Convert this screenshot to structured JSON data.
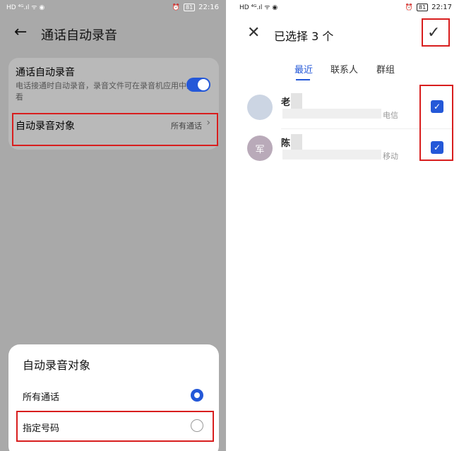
{
  "left": {
    "status": {
      "time": "22:16",
      "battery": "81",
      "signal": "HD ⁴ᴳ.ıl ᯤ ◉"
    },
    "title": "通话自动录音",
    "auto_record": {
      "title": "通话自动录音",
      "desc": "电话接通时自动录音，录音文件可在录音机应用中查看"
    },
    "target": {
      "title": "自动录音对象",
      "value": "所有通话"
    },
    "sheet": {
      "title": "自动录音对象",
      "options": [
        {
          "label": "所有通话",
          "selected": true
        },
        {
          "label": "指定号码",
          "selected": false
        }
      ]
    }
  },
  "right": {
    "status": {
      "time": "22:17",
      "battery": "81",
      "signal": "HD ⁴ᴳ.ıl ᯤ ◉"
    },
    "title": "已选择 3 个",
    "tabs": [
      "最近",
      "联系人",
      "群组"
    ],
    "contacts": [
      {
        "name": "老",
        "carrier": "电信",
        "avatar_text": "",
        "checked": true
      },
      {
        "name": "陈",
        "carrier": "移动",
        "avatar_text": "军",
        "checked": true
      }
    ]
  },
  "colors": {
    "accent": "#2458d8",
    "highlight": "#d81e1e",
    "dim_overlay": "#a9a9a9"
  },
  "icons": [
    "back-arrow-icon",
    "close-icon",
    "check-icon",
    "chevron-right-icon",
    "alarm-icon",
    "wifi-icon"
  ]
}
